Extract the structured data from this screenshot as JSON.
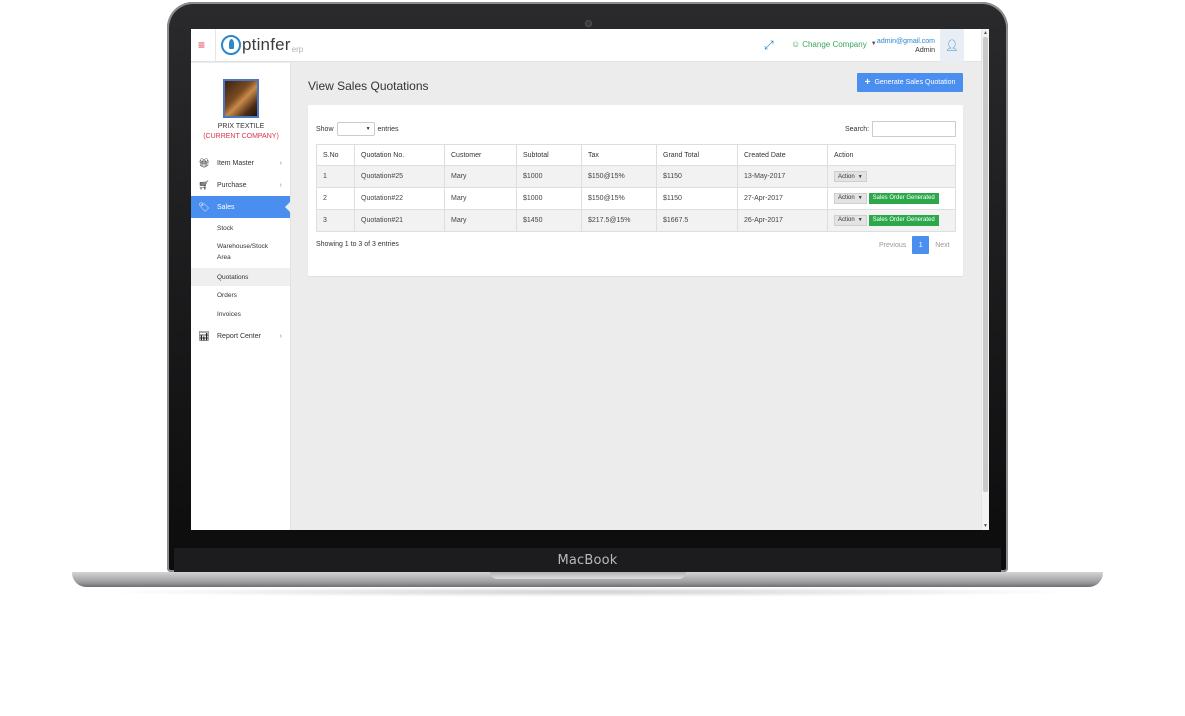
{
  "device": {
    "brand": "MacBook"
  },
  "header": {
    "logo_text": "ptinfer",
    "logo_sub": "erp",
    "company_link": "Change Company",
    "user_email": "admin@gmail.com",
    "user_role": "Admin"
  },
  "sidebar": {
    "company_name": "PRIX TEXTILE",
    "company_status": "(CURRENT COMPANY)",
    "items": [
      {
        "label": "Item Master",
        "icon": "gift-icon"
      },
      {
        "label": "Purchase",
        "icon": "cart-icon"
      },
      {
        "label": "Sales",
        "icon": "tags-icon"
      },
      {
        "label": "Report Center",
        "icon": "bar-chart-icon"
      }
    ],
    "sales_sub": [
      "Stock",
      "Warehouse/Stock Area",
      "Quotations",
      "Orders",
      "Invoices"
    ]
  },
  "main": {
    "title": "View Sales Quotations",
    "generate_button": "Generate Sales Quotation",
    "show_label": "Show",
    "entries_label": "entries",
    "search_label": "Search:",
    "search_value": "",
    "columns": [
      "S.No",
      "Quotation No.",
      "Customer",
      "Subtotal",
      "Tax",
      "Grand Total",
      "Created Date",
      "Action"
    ],
    "rows": [
      {
        "sno": "1",
        "quotation": "Quotation#25",
        "customer": "Mary",
        "subtotal": "$1000",
        "tax": "$150@15%",
        "grand_total": "$1150",
        "date": "13-May-2017",
        "action": "Action",
        "status": ""
      },
      {
        "sno": "2",
        "quotation": "Quotation#22",
        "customer": "Mary",
        "subtotal": "$1000",
        "tax": "$150@15%",
        "grand_total": "$1150",
        "date": "27-Apr-2017",
        "action": "Action",
        "status": "Sales Order Generated"
      },
      {
        "sno": "3",
        "quotation": "Quotation#21",
        "customer": "Mary",
        "subtotal": "$1450",
        "tax": "$217.5@15%",
        "grand_total": "$1667.5",
        "date": "26-Apr-2017",
        "action": "Action",
        "status": "Sales Order Generated"
      }
    ],
    "showing_info": "Showing 1 to 3 of 3 entries",
    "pagination": {
      "previous": "Previous",
      "current": "1",
      "next": "Next"
    }
  },
  "colors": {
    "accent": "#4a8ff0",
    "success": "#2ca84b",
    "danger": "#d9334b"
  }
}
